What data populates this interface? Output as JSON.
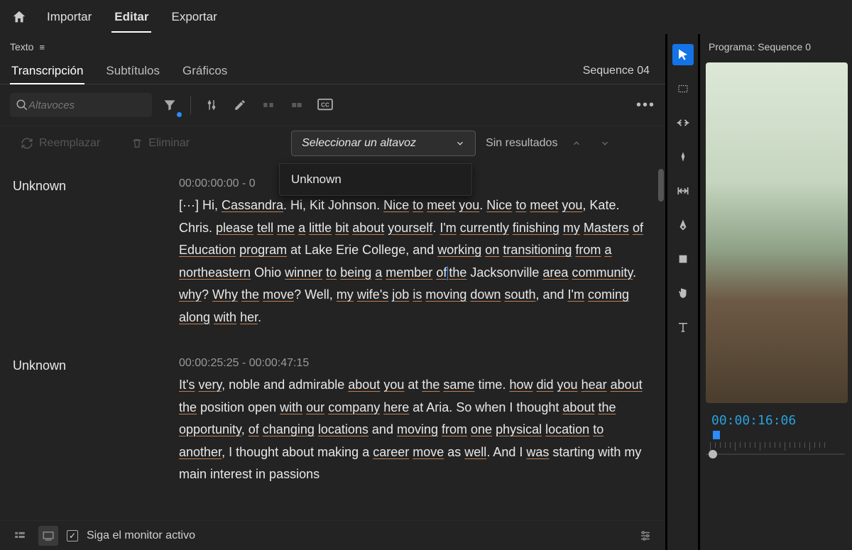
{
  "topbar": {
    "tabs": {
      "import": "Importar",
      "edit": "Editar",
      "export": "Exportar"
    }
  },
  "panel": {
    "title": "Texto"
  },
  "subtabs": {
    "transcription": "Transcripción",
    "subtitles": "Subtítulos",
    "graphics": "Gráficos"
  },
  "sequence": "Sequence 04",
  "search": {
    "placeholder": "Altavoces"
  },
  "actions": {
    "replace": "Reemplazar",
    "delete": "Eliminar"
  },
  "speakerSelect": {
    "label": "Seleccionar un altavoz"
  },
  "noResults": "Sin resultados",
  "dropdown": {
    "items": [
      "Unknown"
    ]
  },
  "transcript": [
    {
      "speaker": "Unknown",
      "time": "00:00:00:00 - 0",
      "text": "[···] Hi, Cassandra. Hi, Kit Johnson. Nice to meet you. Nice to meet you, Kate. Chris. please tell me a little bit about yourself. I'm currently finishing my Masters of Education program at Lake Erie College, and working on transitioning from a northeastern Ohio winner to being a member of the Jacksonville area community. why? Why the move? Well, my wife's job is moving down south, and I'm coming along with her."
    },
    {
      "speaker": "Unknown",
      "time": "00:00:25:25 - 00:00:47:15",
      "text": "It's very, noble and admirable about you at the same time. how did you hear about the position open with our company here at Aria. So when I thought about the opportunity, of changing locations and moving from one physical location to another, I thought about making a career move as well. And I was starting with my main interest in passions"
    }
  ],
  "footer": {
    "followMonitor": "Siga el monitor activo"
  },
  "program": {
    "title": "Programa: Sequence 0",
    "timecode": "00:00:16:06"
  }
}
